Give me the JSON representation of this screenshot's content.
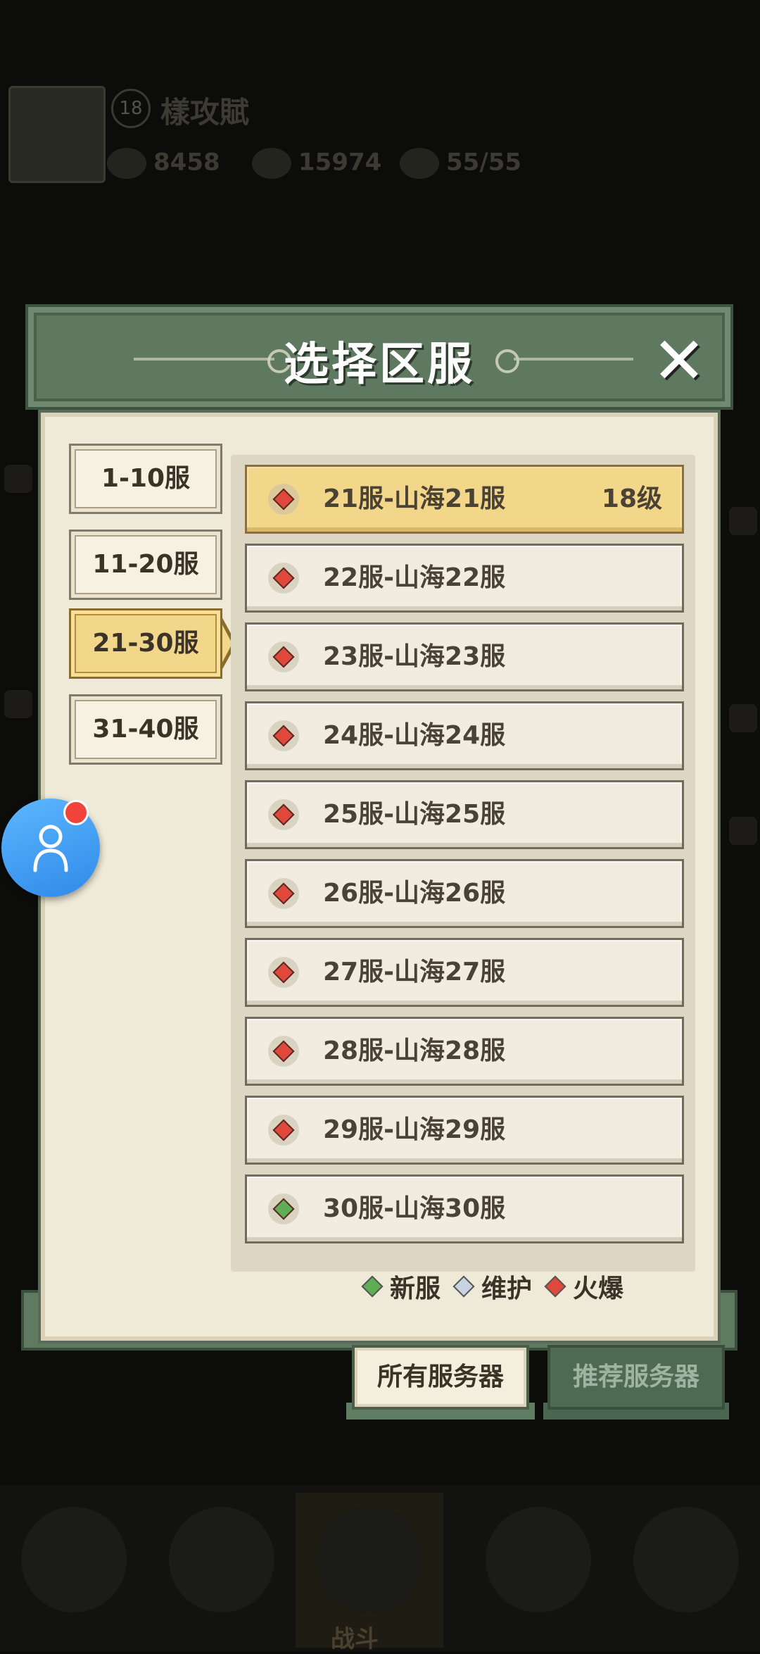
{
  "background": {
    "player_level": "18",
    "player_name": "樣攻賦",
    "stats": [
      "8458",
      "15974",
      "55/55"
    ],
    "bottom_active_tab": "战斗"
  },
  "dialog": {
    "title": "选择区服",
    "close_icon": "close-icon",
    "categories": [
      {
        "label": "1-10服",
        "active": false
      },
      {
        "label": "11-20服",
        "active": false
      },
      {
        "label": "21-30服",
        "active": true
      },
      {
        "label": "31-40服",
        "active": false
      }
    ],
    "servers": [
      {
        "name": "21服-山海21服",
        "level": "18级",
        "status": "hot",
        "selected": true
      },
      {
        "name": "22服-山海22服",
        "level": "",
        "status": "hot",
        "selected": false
      },
      {
        "name": "23服-山海23服",
        "level": "",
        "status": "hot",
        "selected": false
      },
      {
        "name": "24服-山海24服",
        "level": "",
        "status": "hot",
        "selected": false
      },
      {
        "name": "25服-山海25服",
        "level": "",
        "status": "hot",
        "selected": false
      },
      {
        "name": "26服-山海26服",
        "level": "",
        "status": "hot",
        "selected": false
      },
      {
        "name": "27服-山海27服",
        "level": "",
        "status": "hot",
        "selected": false
      },
      {
        "name": "28服-山海28服",
        "level": "",
        "status": "hot",
        "selected": false
      },
      {
        "name": "29服-山海29服",
        "level": "",
        "status": "hot",
        "selected": false
      },
      {
        "name": "30服-山海30服",
        "level": "",
        "status": "new",
        "selected": false
      }
    ],
    "legend": [
      {
        "label": "新服",
        "status": "new"
      },
      {
        "label": "维护",
        "status": "maintenance"
      },
      {
        "label": "火爆",
        "status": "hot"
      }
    ],
    "bottom_tabs": [
      {
        "label": "所有服务器",
        "active": true
      },
      {
        "label": "推荐服务器",
        "active": false
      }
    ]
  },
  "status_colors": {
    "new": "#5fae55",
    "maintenance": "#c9d2e3",
    "hot": "#e0483c"
  },
  "floating_button_icon": "person-icon"
}
